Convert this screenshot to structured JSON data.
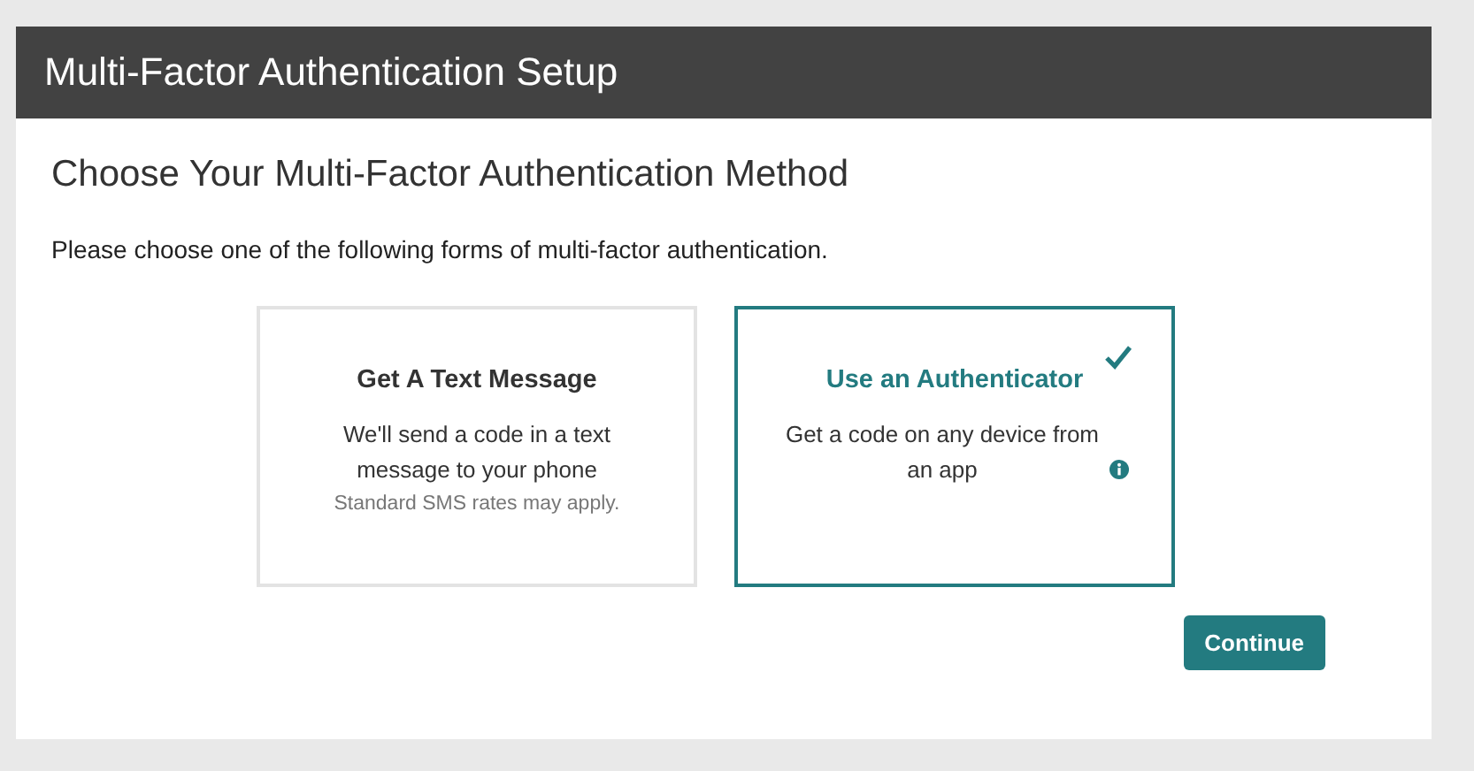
{
  "window": {
    "title": "Multi-Factor Authentication Setup"
  },
  "heading": "Choose Your Multi-Factor Authentication Method",
  "instructions": "Please choose one of the following forms of multi-factor authentication.",
  "options": [
    {
      "title": "Get A Text Message",
      "description": "We'll send a code in a text message to your phone",
      "note": "Standard SMS rates may apply.",
      "info": false,
      "selected": false
    },
    {
      "title": "Use an Authenticator",
      "description": "Get a code on any device from an app",
      "info": true,
      "selected": true
    }
  ],
  "buttons": [
    "Continue"
  ]
}
